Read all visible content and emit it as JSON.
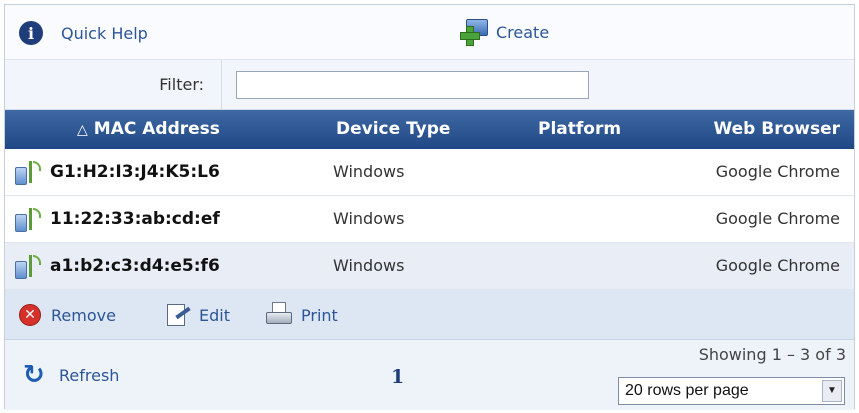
{
  "toolbar": {
    "quick_help_label": "Quick Help",
    "create_label": "Create"
  },
  "filter": {
    "label": "Filter:",
    "value": "",
    "placeholder": ""
  },
  "table": {
    "columns": [
      {
        "label": "MAC Address",
        "sort_indicator": "△"
      },
      {
        "label": "Device Type"
      },
      {
        "label": "Platform"
      },
      {
        "label": "Web Browser"
      }
    ],
    "rows": [
      {
        "mac": "G1:H2:I3:J4:K5:L6",
        "device_type": "Windows",
        "platform": "",
        "browser": "Google Chrome",
        "icon": "wireless-device-icon"
      },
      {
        "mac": "11:22:33:ab:cd:ef",
        "device_type": "Windows",
        "platform": "",
        "browser": "Google Chrome",
        "icon": "wireless-device-icon"
      },
      {
        "mac": "a1:b2:c3:d4:e5:f6",
        "device_type": "Windows",
        "platform": "",
        "browser": "Google Chrome",
        "icon": "wireless-device-icon"
      }
    ]
  },
  "actions": {
    "remove_label": "Remove",
    "edit_label": "Edit",
    "print_label": "Print"
  },
  "footer": {
    "refresh_label": "Refresh",
    "current_page": "1",
    "showing_text": "Showing 1 – 3 of 3",
    "rows_per_page": "20 rows per page"
  },
  "colors": {
    "header_bg": "#1f4785",
    "link": "#2c5696",
    "selected_row": "#e8edf6",
    "actions_bg": "#dde6f3"
  }
}
